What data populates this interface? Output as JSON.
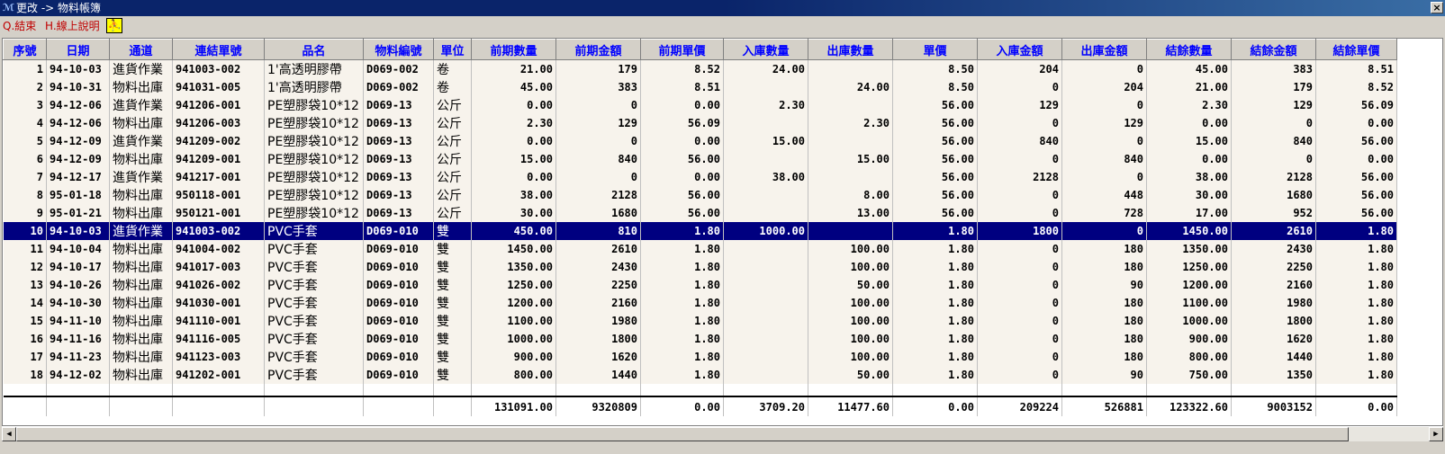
{
  "window": {
    "title": "更改 -> 物料帳簿",
    "icon": "app-logo-icon",
    "close_label": "×"
  },
  "menu": {
    "items": [
      {
        "label": "Q.結束"
      },
      {
        "label": "H.線上說明"
      }
    ],
    "tool_icon": "exit-run-icon",
    "tool_glyph": "⛹"
  },
  "table": {
    "columns": [
      "序號",
      "日期",
      "通道",
      "連結單號",
      "品名",
      "物料編號",
      "單位",
      "前期數量",
      "前期金額",
      "前期單價",
      "入庫數量",
      "出庫數量",
      "單價",
      "入庫金額",
      "出庫金額",
      "結餘數量",
      "結餘金額",
      "結餘單價"
    ],
    "rows": [
      [
        "1",
        "94-10-03",
        "進貨作業",
        "941003-002",
        "1'高透明膠帶",
        "D069-002",
        "卷",
        "21.00",
        "179",
        "8.52",
        "24.00",
        "",
        "8.50",
        "204",
        "0",
        "45.00",
        "383",
        "8.51"
      ],
      [
        "2",
        "94-10-31",
        "物料出庫",
        "941031-005",
        "1'高透明膠帶",
        "D069-002",
        "卷",
        "45.00",
        "383",
        "8.51",
        "",
        "24.00",
        "8.50",
        "0",
        "204",
        "21.00",
        "179",
        "8.52"
      ],
      [
        "3",
        "94-12-06",
        "進貨作業",
        "941206-001",
        "PE塑膠袋10*12",
        "D069-13",
        "公斤",
        "0.00",
        "0",
        "0.00",
        "2.30",
        "",
        "56.00",
        "129",
        "0",
        "2.30",
        "129",
        "56.09"
      ],
      [
        "4",
        "94-12-06",
        "物料出庫",
        "941206-003",
        "PE塑膠袋10*12",
        "D069-13",
        "公斤",
        "2.30",
        "129",
        "56.09",
        "",
        "2.30",
        "56.00",
        "0",
        "129",
        "0.00",
        "0",
        "0.00"
      ],
      [
        "5",
        "94-12-09",
        "進貨作業",
        "941209-002",
        "PE塑膠袋10*12",
        "D069-13",
        "公斤",
        "0.00",
        "0",
        "0.00",
        "15.00",
        "",
        "56.00",
        "840",
        "0",
        "15.00",
        "840",
        "56.00"
      ],
      [
        "6",
        "94-12-09",
        "物料出庫",
        "941209-001",
        "PE塑膠袋10*12",
        "D069-13",
        "公斤",
        "15.00",
        "840",
        "56.00",
        "",
        "15.00",
        "56.00",
        "0",
        "840",
        "0.00",
        "0",
        "0.00"
      ],
      [
        "7",
        "94-12-17",
        "進貨作業",
        "941217-001",
        "PE塑膠袋10*12",
        "D069-13",
        "公斤",
        "0.00",
        "0",
        "0.00",
        "38.00",
        "",
        "56.00",
        "2128",
        "0",
        "38.00",
        "2128",
        "56.00"
      ],
      [
        "8",
        "95-01-18",
        "物料出庫",
        "950118-001",
        "PE塑膠袋10*12",
        "D069-13",
        "公斤",
        "38.00",
        "2128",
        "56.00",
        "",
        "8.00",
        "56.00",
        "0",
        "448",
        "30.00",
        "1680",
        "56.00"
      ],
      [
        "9",
        "95-01-21",
        "物料出庫",
        "950121-001",
        "PE塑膠袋10*12",
        "D069-13",
        "公斤",
        "30.00",
        "1680",
        "56.00",
        "",
        "13.00",
        "56.00",
        "0",
        "728",
        "17.00",
        "952",
        "56.00"
      ],
      [
        "10",
        "94-10-03",
        "進貨作業",
        "941003-002",
        "PVC手套",
        "D069-010",
        "雙",
        "450.00",
        "810",
        "1.80",
        "1000.00",
        "",
        "1.80",
        "1800",
        "0",
        "1450.00",
        "2610",
        "1.80"
      ],
      [
        "11",
        "94-10-04",
        "物料出庫",
        "941004-002",
        "PVC手套",
        "D069-010",
        "雙",
        "1450.00",
        "2610",
        "1.80",
        "",
        "100.00",
        "1.80",
        "0",
        "180",
        "1350.00",
        "2430",
        "1.80"
      ],
      [
        "12",
        "94-10-17",
        "物料出庫",
        "941017-003",
        "PVC手套",
        "D069-010",
        "雙",
        "1350.00",
        "2430",
        "1.80",
        "",
        "100.00",
        "1.80",
        "0",
        "180",
        "1250.00",
        "2250",
        "1.80"
      ],
      [
        "13",
        "94-10-26",
        "物料出庫",
        "941026-002",
        "PVC手套",
        "D069-010",
        "雙",
        "1250.00",
        "2250",
        "1.80",
        "",
        "50.00",
        "1.80",
        "0",
        "90",
        "1200.00",
        "2160",
        "1.80"
      ],
      [
        "14",
        "94-10-30",
        "物料出庫",
        "941030-001",
        "PVC手套",
        "D069-010",
        "雙",
        "1200.00",
        "2160",
        "1.80",
        "",
        "100.00",
        "1.80",
        "0",
        "180",
        "1100.00",
        "1980",
        "1.80"
      ],
      [
        "15",
        "94-11-10",
        "物料出庫",
        "941110-001",
        "PVC手套",
        "D069-010",
        "雙",
        "1100.00",
        "1980",
        "1.80",
        "",
        "100.00",
        "1.80",
        "0",
        "180",
        "1000.00",
        "1800",
        "1.80"
      ],
      [
        "16",
        "94-11-16",
        "物料出庫",
        "941116-005",
        "PVC手套",
        "D069-010",
        "雙",
        "1000.00",
        "1800",
        "1.80",
        "",
        "100.00",
        "1.80",
        "0",
        "180",
        "900.00",
        "1620",
        "1.80"
      ],
      [
        "17",
        "94-11-23",
        "物料出庫",
        "941123-003",
        "PVC手套",
        "D069-010",
        "雙",
        "900.00",
        "1620",
        "1.80",
        "",
        "100.00",
        "1.80",
        "0",
        "180",
        "800.00",
        "1440",
        "1.80"
      ],
      [
        "18",
        "94-12-02",
        "物料出庫",
        "941202-001",
        "PVC手套",
        "D069-010",
        "雙",
        "800.00",
        "1440",
        "1.80",
        "",
        "50.00",
        "1.80",
        "0",
        "90",
        "750.00",
        "1350",
        "1.80"
      ]
    ],
    "selected_row": 9,
    "totals": [
      "",
      "",
      "",
      "",
      "",
      "",
      "",
      "131091.00",
      "9320809",
      "0.00",
      "3709.20",
      "11477.60",
      "0.00",
      "209224",
      "526881",
      "123322.60",
      "9003152",
      "0.00"
    ]
  },
  "scrollbar": {
    "left_icon": "scroll-left-arrow-icon",
    "right_icon": "scroll-right-arrow-icon",
    "left_glyph": "◀",
    "right_glyph": "▶"
  },
  "colors": {
    "header_text": "#0000ff",
    "selection": "#000080",
    "menu_text": "#c00000",
    "titlebar": "#0a246a"
  }
}
